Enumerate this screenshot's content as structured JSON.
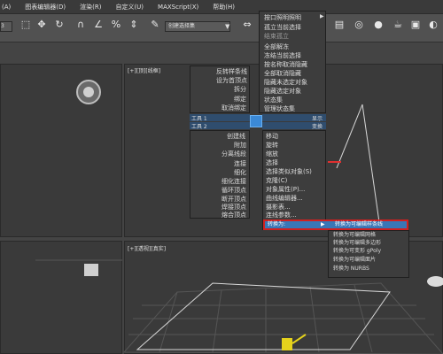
{
  "menubar": {
    "items": [
      "图表编辑器(D)",
      "渲染(R)",
      "自定义(U)",
      "MAXScript(X)",
      "帮助(H)"
    ],
    "left_edge": "(A)"
  },
  "toolbar": {
    "selection_set_placeholder": "创建选择集",
    "combo_left": "3"
  },
  "viewports": {
    "top_label": "[+][顶][线框]",
    "persp_label": "[+][透视][真实]"
  },
  "context_menu": {
    "left_top_items": [
      "孤立当前选择",
      "全部解冻",
      "冻结当前选择",
      "按名称取消隐藏",
      "全部取消隐藏",
      "隐藏未选定对象",
      "隐藏选定对象"
    ],
    "top_header": "按口照明照明",
    "top_header2": "结束孤立",
    "left_quad_top": [
      "反转样条线",
      "设为首顶点",
      "拆分",
      "绑定",
      "取消绑定"
    ],
    "right_quad_top": [
      "状态集",
      "管理状态集"
    ],
    "tool1": "工具 1",
    "tool2": "工具 2",
    "display_label": "显示",
    "transform_label": "变换",
    "left_quad_bottom": [
      "创建线",
      "附加",
      "分离线段",
      "连接",
      "细化",
      "细化连接",
      "循环顶点",
      "断开顶点",
      "焊接顶点",
      "熔合顶点"
    ],
    "right_quad_bottom": [
      "移动",
      "旋转",
      "缩放",
      "选择",
      "选择类似对象(S)",
      "克隆(C)",
      "对象属性(P)...",
      "曲线编辑器...",
      "摄影表...",
      "连线参数...",
      "转换为:"
    ],
    "submenu": [
      "转换为可编辑样条线",
      "转换为可编辑网格",
      "转换为可编辑多边形",
      "转换为可变形 gPoly",
      "转换为可编辑面片",
      "转换为 NURBS"
    ]
  }
}
